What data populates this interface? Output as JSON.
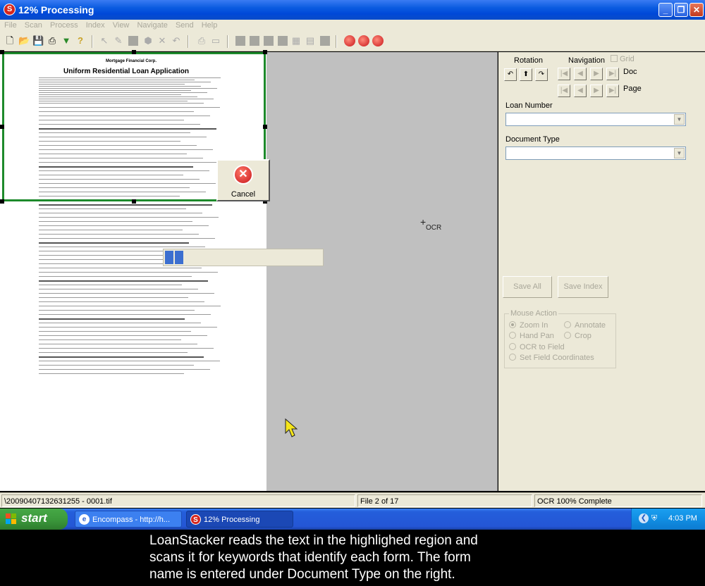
{
  "window": {
    "title": "12% Processing",
    "icon": "loanstacker-app-icon"
  },
  "menu": [
    "File",
    "Scan",
    "Process",
    "Index",
    "View",
    "Navigate",
    "Send",
    "Help"
  ],
  "document_preview": {
    "company": "Mortgage Financial Corp.",
    "form_title": "Uniform Residential Loan Application"
  },
  "overlay": {
    "cancel_label": "Cancel",
    "progress_percent": 12,
    "ocr_cursor_label": "OCR"
  },
  "panel": {
    "rotation_label": "Rotation",
    "navigation_label": "Navigation",
    "grid_label": "Grid",
    "doc_label": "Doc",
    "page_label": "Page",
    "loan_number_label": "Loan Number",
    "loan_number_value": "",
    "document_type_label": "Document Type",
    "document_type_value": "",
    "save_all_label": "Save All",
    "save_index_label": "Save Index",
    "mouse_action": {
      "legend": "Mouse Action",
      "options": [
        "Zoom In",
        "Annotate",
        "Hand Pan",
        "Crop",
        "OCR to Field",
        "Set Field Coordinates"
      ],
      "selected": "Zoom In"
    }
  },
  "status": {
    "file_path": "\\20090407132631255 - 0001.tif",
    "file_position": "File 2 of 17",
    "ocr_status": "OCR 100% Complete"
  },
  "taskbar": {
    "start_label": "start",
    "tasks": [
      {
        "label": "Encompass - http://h...",
        "icon": "encompass-icon"
      },
      {
        "label": "12% Processing",
        "icon": "loanstacker-icon"
      }
    ],
    "clock": "4:03 PM"
  },
  "caption": "LoanStacker reads the text in the highlighed region and\nscans it for keywords that identify each form. The form\nname is entered under Document Type on the right.",
  "colors": {
    "selection_border": "#1d8a2b",
    "progress_fill": "#3c6fd0",
    "titlebar": "#0a5be0"
  }
}
